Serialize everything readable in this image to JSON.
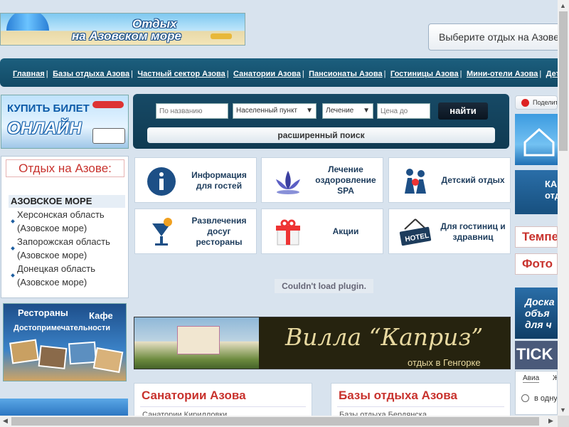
{
  "logo": {
    "line1": "Отдых",
    "line2": "на Азовском море"
  },
  "region_select": {
    "value": "Выберите отдых на Азове"
  },
  "nav": {
    "items": [
      "Главная",
      "Базы отдыха Азова",
      "Частный сектор Азова",
      "Санатории Азова",
      "Пансионаты Азова",
      "Гостиницы Азова",
      "Мини-отели Азова",
      "Детские лагеря Азова"
    ],
    "separator": "|"
  },
  "ticket_banner": {
    "line1": "КУПИТЬ БИЛЕТ",
    "line2": "ОНЛАЙН"
  },
  "search": {
    "name_placeholder": "По названию",
    "locality_value": "Населенный пункт",
    "treatment_value": "Лечение",
    "price_placeholder": "Цена до",
    "submit_label": "найти",
    "advanced_label": "расширенный поиск"
  },
  "left_box": {
    "title": "Отдых на Азове:",
    "heading": "АЗОВСКОЕ МОРЕ",
    "regions": [
      {
        "line1": "Херсонская область",
        "line2": "(Азовское море)"
      },
      {
        "line1": "Запорожская область",
        "line2": "(Азовское море)"
      },
      {
        "line1": "Донецкая область",
        "line2": "(Азовское море)"
      }
    ]
  },
  "restaurants_banner": {
    "line1": "Рестораны",
    "line2": "Кафе",
    "line3": "Достопримечательности"
  },
  "tiles": [
    {
      "label": "Информация для гостей",
      "icon": "info-icon"
    },
    {
      "label": "Лечение оздоровление SPA",
      "icon": "lotus-icon"
    },
    {
      "label": "Детский отдых",
      "icon": "children-icon"
    },
    {
      "label": "Развлечения досуг рестораны",
      "icon": "cocktail-icon"
    },
    {
      "label": "Акции",
      "icon": "gift-icon"
    },
    {
      "label": "Для гостиниц и здравниц",
      "icon": "hotel-sign-icon"
    }
  ],
  "plugin_message": "Couldn't load plugin.",
  "villa_banner": {
    "name": "Вилла “Каприз”",
    "subtitle": "отдых в Генгорке"
  },
  "sections": [
    {
      "title": "Санатории Азова",
      "first_item": "Санатории Кирилловки"
    },
    {
      "title": "Базы отдыха Азова",
      "first_item": "Базы отдыха Бердянска"
    }
  ],
  "right": {
    "lang_label": "Поделиться",
    "banner2": "КА отдых",
    "link1": "Темпе",
    "link2": "Фото",
    "banner5": "Доска объя для ч",
    "banner6": "TICK",
    "tabs": [
      "Авиа",
      "Ж"
    ],
    "radio_label": "в одну"
  }
}
